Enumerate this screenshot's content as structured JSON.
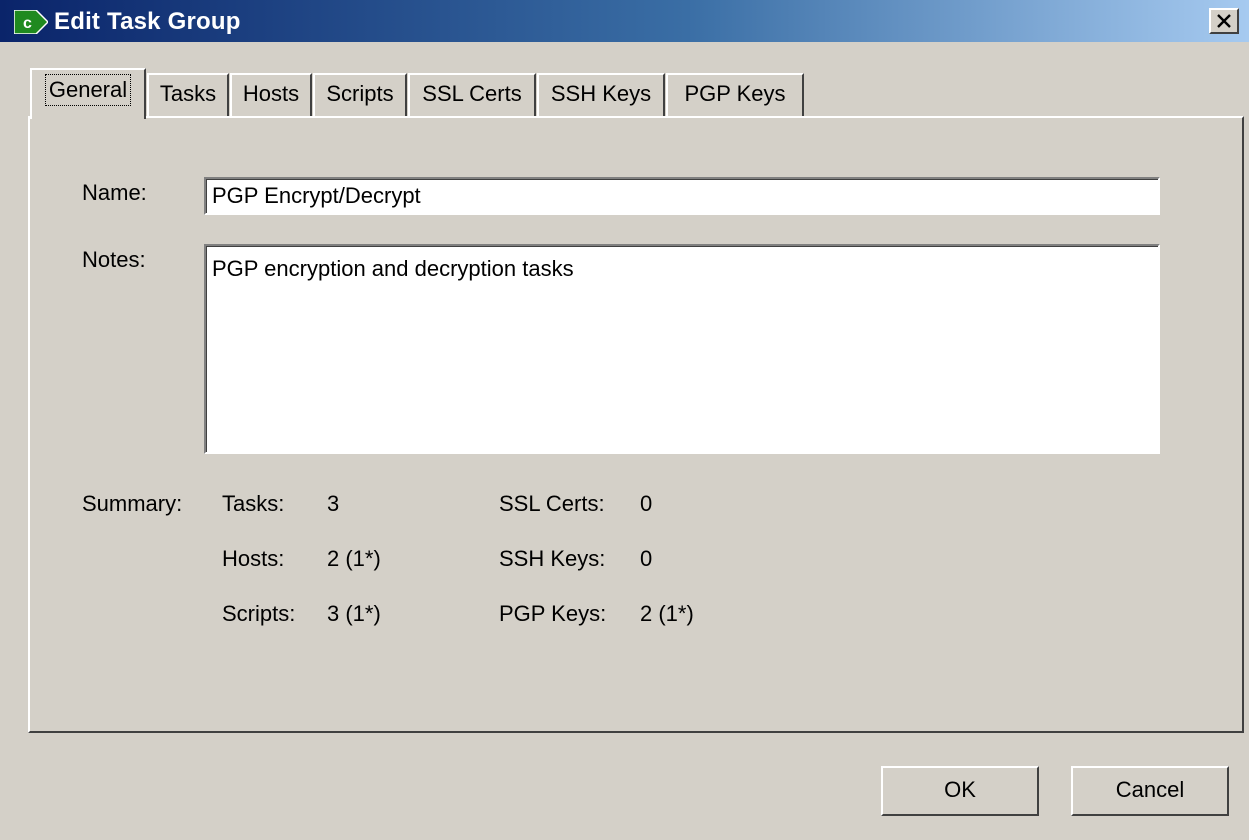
{
  "window": {
    "title": "Edit Task Group",
    "icon": "app-c-arrow-icon",
    "close_icon": "close-icon"
  },
  "tabs": [
    {
      "label": "General",
      "active": true
    },
    {
      "label": "Tasks",
      "active": false
    },
    {
      "label": "Hosts",
      "active": false
    },
    {
      "label": "Scripts",
      "active": false
    },
    {
      "label": "SSL Certs",
      "active": false
    },
    {
      "label": "SSH Keys",
      "active": false
    },
    {
      "label": "PGP Keys",
      "active": false
    }
  ],
  "general": {
    "name_label": "Name:",
    "name_value": "PGP Encrypt/Decrypt",
    "notes_label": "Notes:",
    "notes_value": "PGP encryption and decryption tasks",
    "summary_label": "Summary:",
    "summary": {
      "tasks_label": "Tasks:",
      "tasks_value": "3",
      "hosts_label": "Hosts:",
      "hosts_value": "2 (1*)",
      "scripts_label": "Scripts:",
      "scripts_value": "3 (1*)",
      "ssl_label": "SSL Certs:",
      "ssl_value": "0",
      "ssh_label": "SSH Keys:",
      "ssh_value": "0",
      "pgp_label": "PGP Keys:",
      "pgp_value": "2 (1*)"
    }
  },
  "buttons": {
    "ok": "OK",
    "cancel": "Cancel"
  },
  "colors": {
    "face": "#d4d0c8",
    "title_start": "#0a246a",
    "title_end": "#a6caf0"
  }
}
